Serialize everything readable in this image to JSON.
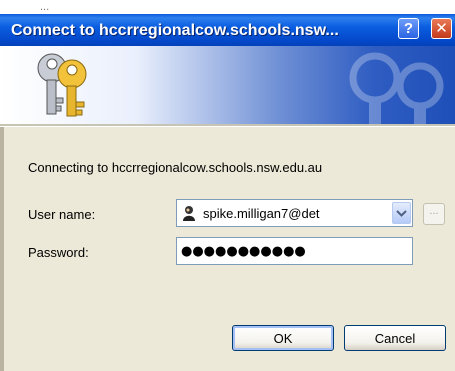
{
  "background": {
    "partial_text": "..."
  },
  "window": {
    "title": "Connect to hccrregionalcow.schools.nsw...",
    "help_label": "?",
    "close_label": "✕"
  },
  "banner": {
    "icon": "keys-icon",
    "watermark": "keys-watermark"
  },
  "dialog": {
    "connecting_text": "Connecting to hccrregionalcow.schools.nsw.edu.au",
    "user_name_label": "User name:",
    "user_name_value": "spike.milligan7@det",
    "password_label": "Password:",
    "password_value": "●●●●●●●●●●●",
    "browse_label": "...",
    "ok_label": "OK",
    "cancel_label": "Cancel"
  },
  "colors": {
    "titlebar": "#0b5ee0",
    "close_button": "#c3391b",
    "help_button": "#2a63e3",
    "dialog_face": "#ece9d8",
    "input_border": "#7f9db9"
  }
}
